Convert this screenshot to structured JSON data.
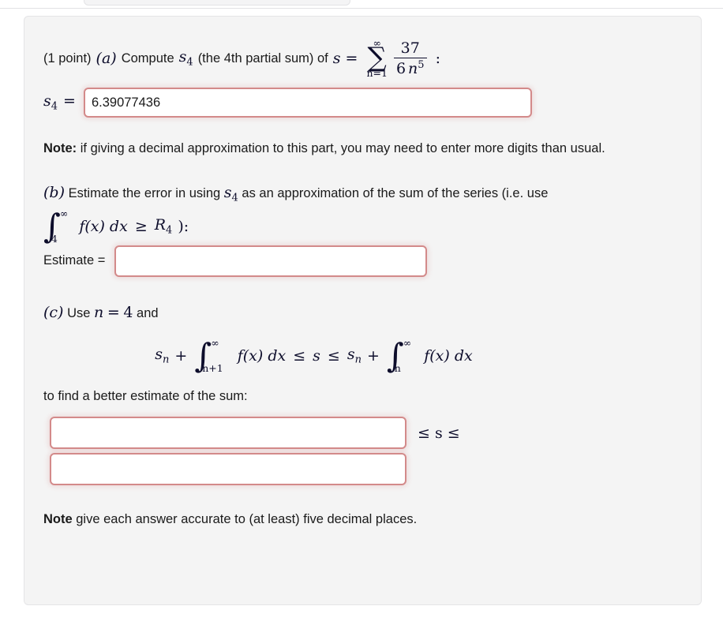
{
  "page": {
    "background_color": "#ffffff",
    "panel_background_color": "#f4f4f4",
    "panel_border_color": "#e4e4e6",
    "input_border_color": "#d38a8a",
    "text_color": "#1a1a1a",
    "math_color": "#0d0d2b"
  },
  "part_a": {
    "points_label": "(1 point)",
    "part_letter": "(a)",
    "prompt_before_sub": "Compute",
    "variable": "s",
    "variable_sub": "4",
    "prompt_middle": "(the 4th partial sum) of",
    "series_variable": "s",
    "equals": "=",
    "sum_upper_limit": "∞",
    "sum_symbol": "∑",
    "sum_lower_limit": "n=1",
    "fraction_numerator": "37",
    "fraction_denominator_coefficient": "6",
    "fraction_denominator_variable": "n",
    "fraction_denominator_exponent": "5",
    "trailing_colon": ":",
    "answer_label_variable": "s",
    "answer_label_sub": "4",
    "answer_label_equals": "=",
    "answer_value": "6.39077436",
    "answer_placeholder": ""
  },
  "note_a": {
    "bold_prefix": "Note:",
    "text": " if giving a decimal approximation to this part, you may need to enter more digits than usual."
  },
  "part_b": {
    "part_letter": "(b)",
    "text_before": "Estimate the error in using",
    "variable": "s",
    "variable_sub": "4",
    "text_after": "as an approximation of the sum of the series (i.e. use",
    "integral_upper": "∞",
    "integral_lower": "4",
    "integrand": "f(x) dx",
    "relation": "≥",
    "remainder": "R",
    "remainder_sub": "4",
    "closing": "):",
    "estimate_label": "Estimate =",
    "estimate_value": "",
    "estimate_placeholder": ""
  },
  "part_c": {
    "part_letter": "(c)",
    "text_before": "Use",
    "variable": "n",
    "equals": "=",
    "value": "4",
    "text_after": "and",
    "formula": {
      "left_term": "s",
      "left_term_sub": "n",
      "plus": "+",
      "left_integral_upper": "∞",
      "left_integral_lower": "n+1",
      "integrand": "f(x) dx",
      "rel1": "≤",
      "middle": "s",
      "rel2": "≤",
      "right_term": "s",
      "right_term_sub": "n",
      "right_integral_upper": "∞",
      "right_integral_lower": "n"
    },
    "instruction": "to find a better estimate of the sum:",
    "lower_bound_value": "",
    "lower_bound_placeholder": "",
    "upper_bound_value": "",
    "upper_bound_placeholder": "",
    "sandwich_operator": "≤  s  ≤"
  },
  "note_final": {
    "bold_prefix": "Note",
    "text": " give each answer accurate to (at least) five decimal places."
  }
}
